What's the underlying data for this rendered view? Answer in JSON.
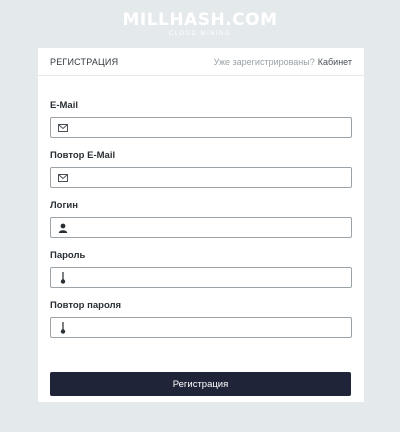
{
  "brand": {
    "name": "MILLHASH.COM",
    "tagline": "CLOUD MINING"
  },
  "header": {
    "title": "РЕГИСТРАЦИЯ",
    "login_prompt": "Уже зарегистрированы?",
    "login_link": "Кабинет"
  },
  "form": {
    "fields": [
      {
        "label": "E-Mail",
        "icon": "envelope-icon",
        "value": ""
      },
      {
        "label": "Повтор E-Mail",
        "icon": "envelope-icon",
        "value": ""
      },
      {
        "label": "Логин",
        "icon": "user-icon",
        "value": ""
      },
      {
        "label": "Пароль",
        "icon": "key-icon",
        "value": ""
      },
      {
        "label": "Повтор пароля",
        "icon": "key-icon",
        "value": ""
      }
    ],
    "submit_label": "Регистрация"
  },
  "colors": {
    "background": "#e4e9ec",
    "button": "#1f2438",
    "card": "#ffffff"
  }
}
